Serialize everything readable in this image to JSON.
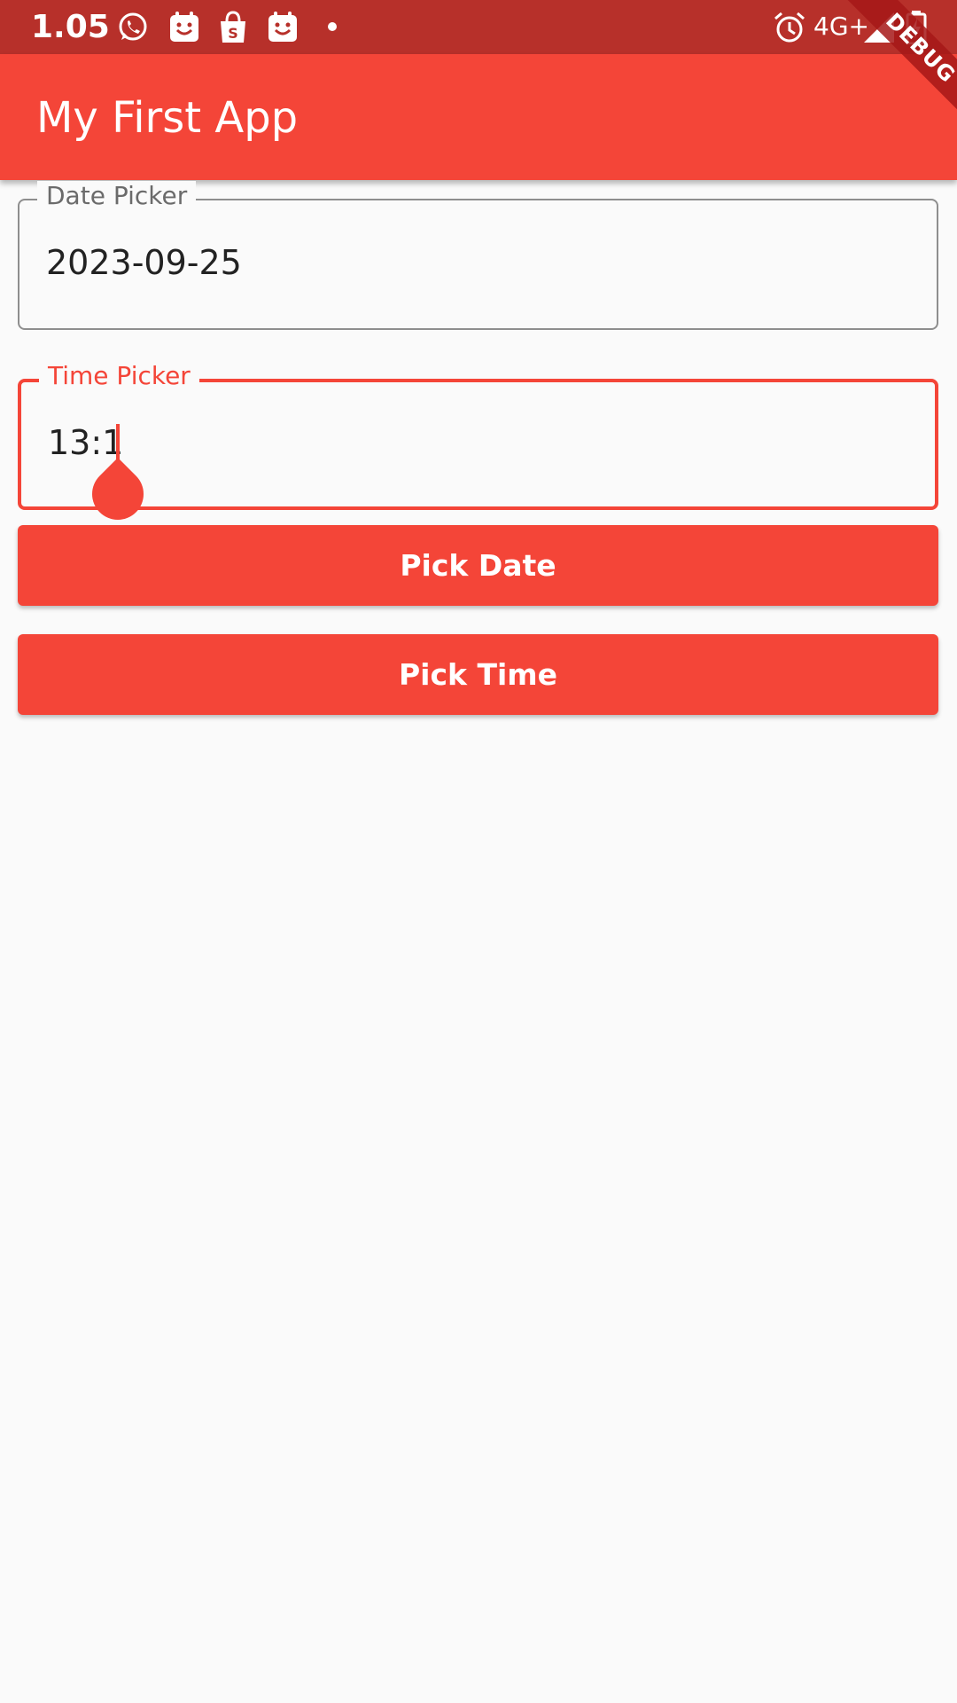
{
  "status_bar": {
    "time": "1.05",
    "network": "4G+",
    "icons": [
      "whatsapp-icon",
      "calendar-icon",
      "shopee-icon",
      "calendar-icon",
      "dot-icon",
      "alarm-icon",
      "signal-icon",
      "battery-charging-icon"
    ]
  },
  "app_bar": {
    "title": "My First App"
  },
  "debug_banner": "DEBUG",
  "date_field": {
    "label": "Date Picker",
    "value": "2023-09-25"
  },
  "time_field": {
    "label": "Time Picker",
    "value": "13:1"
  },
  "buttons": {
    "pick_date": "Pick Date",
    "pick_time": "Pick Time"
  },
  "colors": {
    "primary": "#f44538",
    "status_bar": "#b7302a",
    "background": "#fafafa"
  }
}
